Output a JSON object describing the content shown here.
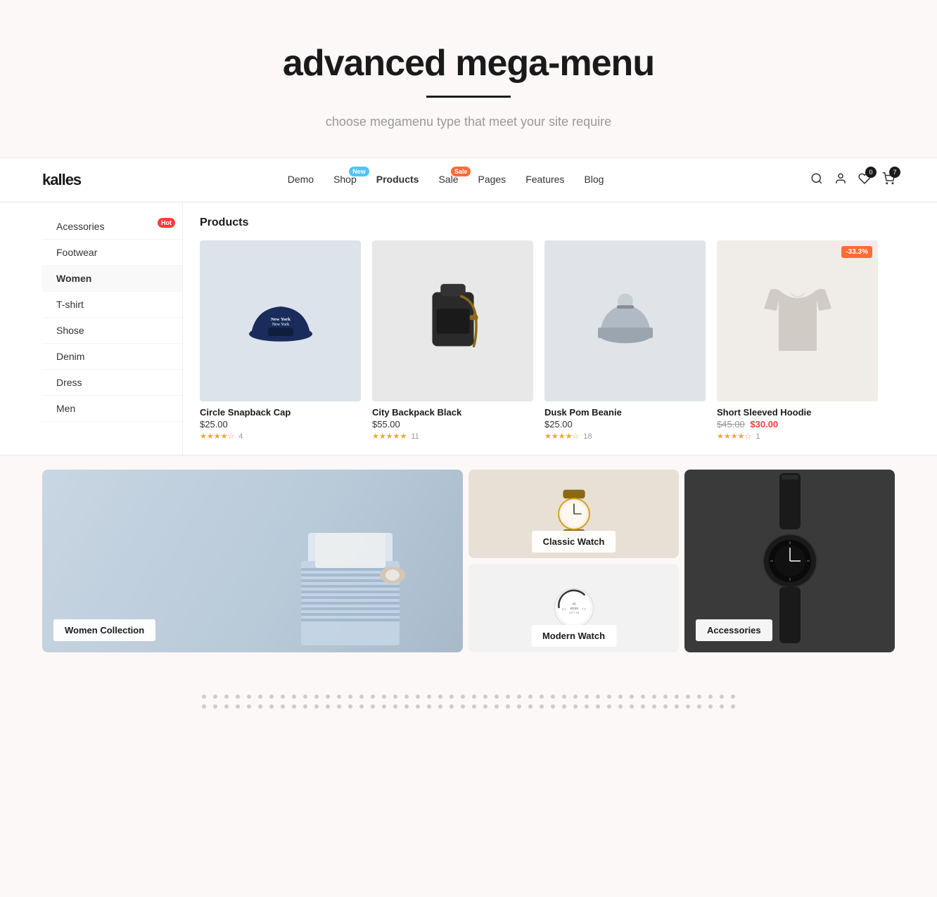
{
  "hero": {
    "title": "advanced mega-menu",
    "divider": true,
    "subtitle": "choose megamenu type that meet your site require"
  },
  "navbar": {
    "logo": "kalles",
    "nav_items": [
      {
        "id": "demo",
        "label": "Demo",
        "badge": null
      },
      {
        "id": "shop",
        "label": "Shop",
        "badge": {
          "text": "New",
          "type": "new"
        }
      },
      {
        "id": "products",
        "label": "Products",
        "badge": null,
        "active": true
      },
      {
        "id": "sale",
        "label": "Sale",
        "badge": {
          "text": "Sale",
          "type": "sale"
        }
      },
      {
        "id": "pages",
        "label": "Pages",
        "badge": null
      },
      {
        "id": "features",
        "label": "Features",
        "badge": null
      },
      {
        "id": "blog",
        "label": "Blog",
        "badge": null
      }
    ],
    "wishlist_count": "0",
    "cart_count": "7"
  },
  "mega_menu": {
    "sidebar": {
      "items": [
        {
          "id": "accessories",
          "label": "Acessories",
          "badge": {
            "text": "Hot",
            "type": "hot"
          }
        },
        {
          "id": "footwear",
          "label": "Footwear"
        },
        {
          "id": "women",
          "label": "Women",
          "active": true
        },
        {
          "id": "tshirt",
          "label": "T-shirt"
        },
        {
          "id": "shoes",
          "label": "Shose"
        },
        {
          "id": "denim",
          "label": "Denim"
        },
        {
          "id": "dress",
          "label": "Dress"
        },
        {
          "id": "men",
          "label": "Men"
        }
      ]
    },
    "products_title": "Products",
    "products": [
      {
        "id": "1",
        "name": "Circle Snapback Cap",
        "price": "$25.00",
        "old_price": null,
        "sale_price": null,
        "stars": 4,
        "reviews": "4",
        "discount": null,
        "emoji": "🧢"
      },
      {
        "id": "2",
        "name": "City Backpack Black",
        "price": "$55.00",
        "old_price": null,
        "sale_price": null,
        "stars": 5,
        "reviews": "11",
        "discount": null,
        "emoji": "🎒"
      },
      {
        "id": "3",
        "name": "Dusk Pom Beanie",
        "price": "$25.00",
        "old_price": null,
        "sale_price": null,
        "stars": 4,
        "reviews": "18",
        "discount": null,
        "emoji": "🧤"
      },
      {
        "id": "4",
        "name": "Short Sleeved Hoodie",
        "price": "$45.00",
        "old_price": "$45.00",
        "sale_price": "$30.00",
        "stars": 4,
        "reviews": "1",
        "discount": "-33.3%",
        "emoji": "👚"
      }
    ]
  },
  "banners": [
    {
      "id": "women-collection",
      "label": "Women Collection",
      "bg": "#c9d8e3",
      "size": "large"
    },
    {
      "id": "classic-watch",
      "label": "Classic Watch",
      "bg": "#f0ede8",
      "size": "small-top"
    },
    {
      "id": "modern-watch",
      "label": "Modern Watch",
      "bg": "#f5f5f5",
      "size": "small-bottom"
    },
    {
      "id": "accessories",
      "label": "Accessories",
      "bg": "#3a3a3a",
      "size": "right"
    }
  ],
  "dots": {
    "rows": 2,
    "cols": 48
  }
}
